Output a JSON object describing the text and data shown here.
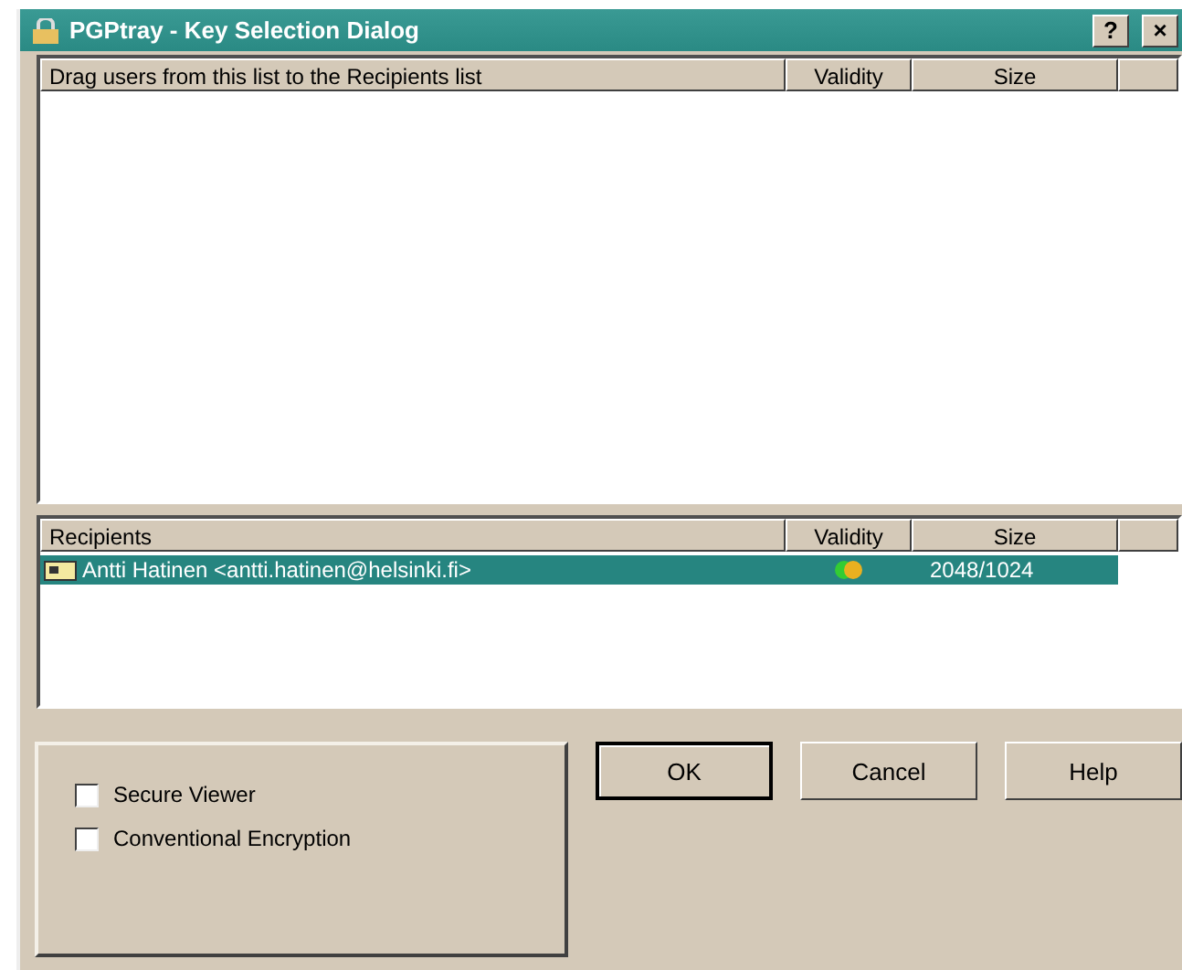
{
  "window": {
    "title": "PGPtray - Key Selection Dialog",
    "title_buttons": [
      "?",
      "×"
    ]
  },
  "keys_list": {
    "columns": [
      "Drag users from this list to the Recipients list",
      "Validity",
      "Size"
    ]
  },
  "recipients_list": {
    "columns": [
      "Recipients",
      "Validity",
      "Size"
    ],
    "rows": [
      {
        "name": "Antti Hatinen <antti.hatinen@helsinki.fi>",
        "size": "2048/1024",
        "selected": true
      }
    ]
  },
  "options": [
    {
      "label": "Secure Viewer",
      "checked": false
    },
    {
      "label": "Conventional Encryption",
      "checked": false
    }
  ],
  "buttons": [
    {
      "label": "OK",
      "default": true
    },
    {
      "label": "Cancel",
      "default": false
    },
    {
      "label": "Help",
      "default": false
    }
  ]
}
